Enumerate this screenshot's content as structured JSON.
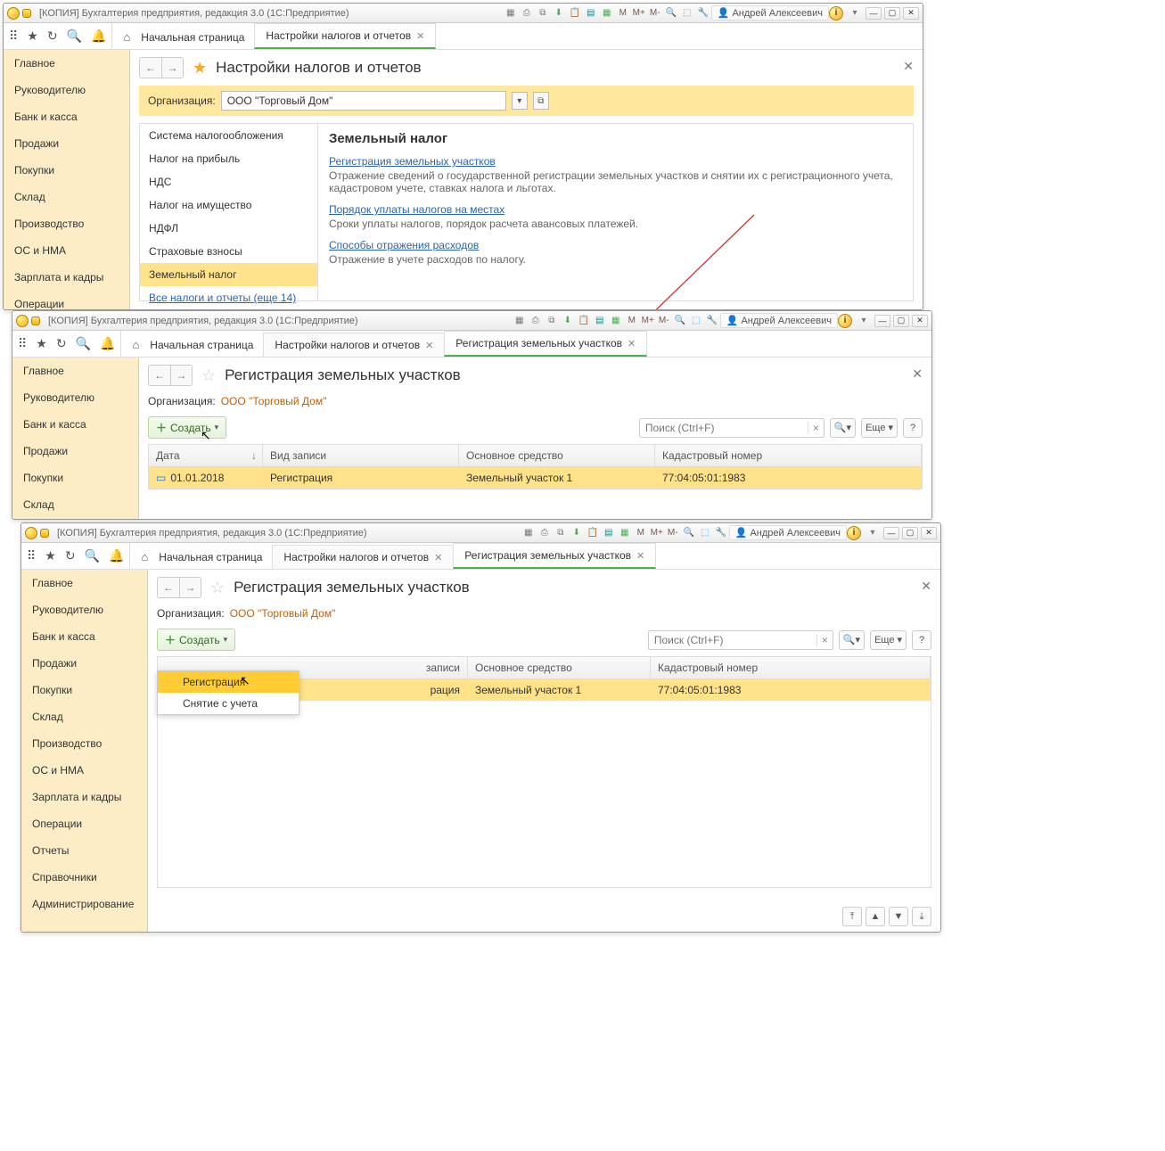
{
  "app_title": "[КОПИЯ] Бухгалтерия предприятия, редакция 3.0  (1С:Предприятие)",
  "user": "Андрей Алексеевич",
  "home_tab": "Начальная страница",
  "nav": [
    "Главное",
    "Руководителю",
    "Банк и касса",
    "Продажи",
    "Покупки",
    "Склад",
    "Производство",
    "ОС и НМА",
    "Зарплата и кадры",
    "Операции",
    "Отчеты",
    "Справочники",
    "Администрирование"
  ],
  "win1": {
    "tabs": [
      "Настройки налогов и отчетов"
    ],
    "title": "Настройки налогов и отчетов",
    "org_label": "Организация:",
    "org_value": "ООО \"Торговый Дом\"",
    "left_items": [
      "Система налогообложения",
      "Налог на прибыль",
      "НДС",
      "Налог на имущество",
      "НДФЛ",
      "Страховые взносы",
      "Земельный налог"
    ],
    "left_link": "Все налоги и отчеты (еще 14)",
    "section_title": "Земельный налог",
    "link1": "Регистрация земельных участков",
    "text1": "Отражение сведений о государственной регистрации земельных участков и снятии их с регистрационного учета, кадастровом учете, ставках налога и льготах.",
    "link2": "Порядок уплаты налогов на местах",
    "text2": "Сроки уплаты налогов, порядок расчета авансовых платежей.",
    "link3": "Способы отражения расходов",
    "text3": "Отражение в учете расходов по налогу."
  },
  "win2": {
    "tabs": [
      "Настройки налогов и отчетов",
      "Регистрация земельных участков"
    ],
    "title": "Регистрация земельных участков",
    "org_label": "Организация:",
    "org_value": "ООО \"Торговый Дом\"",
    "create": "Создать",
    "search_ph": "Поиск (Ctrl+F)",
    "more": "Еще",
    "cols": {
      "date": "Дата",
      "type": "Вид записи",
      "os": "Основное средство",
      "kn": "Кадастровый номер"
    },
    "row": {
      "date": "01.01.2018",
      "type": "Регистрация",
      "os": "Земельный участок 1",
      "kn": "77:04:05:01:1983"
    }
  },
  "win3": {
    "tabs": [
      "Настройки налогов и отчетов",
      "Регистрация земельных участков"
    ],
    "title": "Регистрация земельных участков",
    "org_label": "Организация:",
    "org_value": "ООО \"Торговый Дом\"",
    "create": "Создать",
    "menu": [
      "Регистрация",
      "Снятие с учета"
    ],
    "search_ph": "Поиск (Ctrl+F)",
    "more": "Еще",
    "cols": {
      "type": "записи",
      "os": "Основное средство",
      "kn": "Кадастровый номер"
    },
    "row": {
      "type": "рация",
      "os": "Земельный участок 1",
      "kn": "77:04:05:01:1983"
    }
  }
}
